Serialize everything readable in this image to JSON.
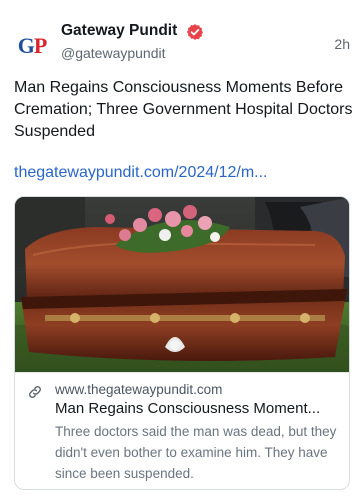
{
  "author": {
    "avatar_text_left": "G",
    "avatar_text_right": "P",
    "name": "Gateway Pundit",
    "handle": "@gatewaypundit",
    "verified_icon": "verified-badge-icon",
    "verified_color": "#e8434b"
  },
  "post": {
    "time": "2h",
    "text": "Man Regains Consciousness Moments Before Cremation; Three Government Hospital Doctors Suspended",
    "link_text": "thegatewaypundit.com/2024/12/m..."
  },
  "card": {
    "image_icon": "casket-photo",
    "link_icon": "link-icon",
    "domain": "www.thegatewaypundit.com",
    "title": "Man Regains Consciousness Moment...",
    "description": "Three doctors said the man was dead, but they didn't even bother to examine him. They have since been suspended."
  },
  "colors": {
    "link": "#2a66c8",
    "brand_blue": "#1f4f9c",
    "brand_red": "#d8262c"
  }
}
